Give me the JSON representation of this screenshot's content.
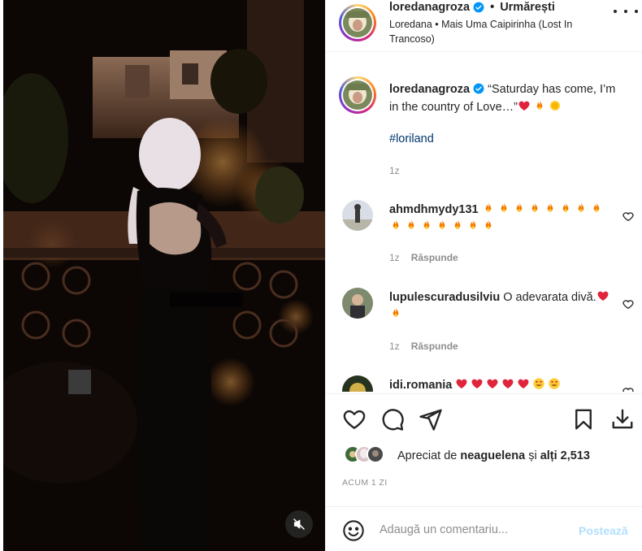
{
  "post": {
    "username": "loredanagroza",
    "separator": "•",
    "follow_label": "Urmărești",
    "audio": "Loredana • Mais Uma Caipirinha (Lost In Trancoso)"
  },
  "caption": {
    "username": "loredanagroza",
    "text": "“Saturday has come, I’m in the country of Love…”",
    "emojis": [
      "heart",
      "fire",
      "sun"
    ],
    "hashtag": "#loriland",
    "time": "1z"
  },
  "comments": [
    {
      "username": "ahmdhmydy131",
      "text": "",
      "emojis": [
        "fire",
        "fire",
        "fire",
        "fire",
        "fire",
        "fire",
        "fire",
        "fire",
        "fire",
        "fire",
        "fire",
        "fire",
        "fire",
        "fire",
        "fire"
      ],
      "time": "1z",
      "reply_label": "Răspunde"
    },
    {
      "username": "lupulescuradusilviu",
      "text": "O adevarata divă.",
      "emojis": [
        "heart",
        "fire"
      ],
      "time": "1z",
      "reply_label": "Răspunde"
    },
    {
      "username": "idi.romania",
      "text": "",
      "emojis": [
        "heart",
        "heart",
        "heart",
        "heart",
        "heart",
        "heart-eyes",
        "heart-eyes"
      ],
      "time": "",
      "reply_label": ""
    }
  ],
  "likes": {
    "prefix": "Apreciat de ",
    "user": "neaguelena",
    "middle": " și ",
    "others": "alți 2,513"
  },
  "date": "ACUM 1 ZI",
  "comment_box": {
    "placeholder": "Adaugă un comentariu...",
    "post_label": "Postează"
  },
  "colors": {
    "link": "#00376b",
    "verified": "#0095f6",
    "post_disabled": "#b2dffc",
    "muted_text": "#8e8e8e"
  },
  "icons": {
    "header_more": "more-horizontal-icon",
    "like": "heart-outline-icon",
    "comment": "comment-bubble-icon",
    "share": "paper-plane-icon",
    "save": "bookmark-icon",
    "download": "download-icon",
    "mute": "speaker-muted-icon",
    "emoji": "smiley-icon"
  }
}
